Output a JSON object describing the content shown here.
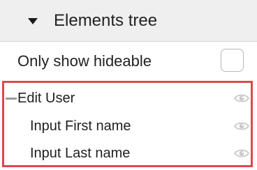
{
  "header": {
    "title": "Elements tree",
    "expand_icon": "caret-down-icon"
  },
  "options": {
    "only_show_hideable_label": "Only show hideable",
    "only_show_hideable_checked": false
  },
  "tree": {
    "items": [
      {
        "label": "Edit User",
        "level": 0,
        "collapse_icon": "minus-icon",
        "visibility_icon": "eye-icon"
      },
      {
        "label": "Input First name",
        "level": 1,
        "visibility_icon": "eye-icon"
      },
      {
        "label": "Input Last name",
        "level": 1,
        "visibility_icon": "eye-icon"
      }
    ],
    "highlight_color": "#e0474d"
  },
  "colors": {
    "header_background": "#efefef",
    "text": "#1f1f1f",
    "icon_muted": "#c8c8c8"
  }
}
